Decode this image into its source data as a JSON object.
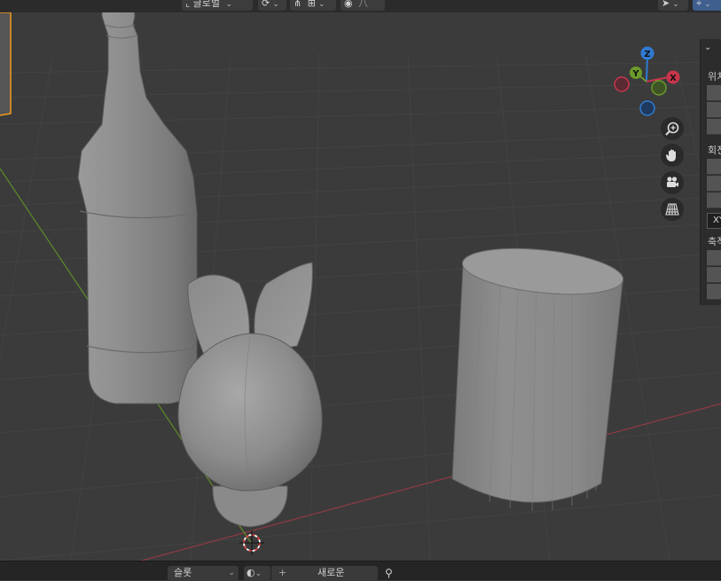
{
  "header": {
    "transform_orientation": "글로벌",
    "header_glyph": "八"
  },
  "gizmo": {
    "z_label": "Z",
    "y_label": "Y",
    "x_label": "X",
    "color_x": "#c9354b",
    "color_y": "#6c9b2a",
    "color_z": "#2f7bd4"
  },
  "nav_tools": [
    "zoom-icon",
    "hand-pan-icon",
    "camera-icon",
    "grid-perspective-icon"
  ],
  "npanel": {
    "location_label": "위치",
    "rotation_label": "회전",
    "rotation_mode": "XY",
    "scale_label": "축적"
  },
  "bottombar": {
    "slot_label": "슬롯",
    "new_button_plus": "+",
    "new_button_label": "새로운"
  },
  "colors": {
    "viewport_bg": "#3b3b3b",
    "axis_x": "#8f3b41",
    "axis_y": "#5f8a2a",
    "object_gray": "#8c8c8c",
    "selection_orange": "#f29a1c"
  }
}
